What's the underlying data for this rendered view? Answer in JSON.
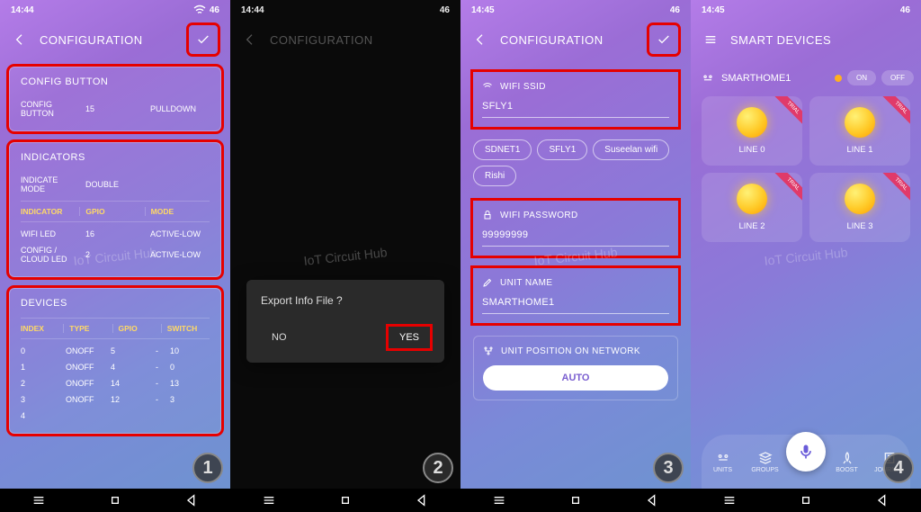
{
  "status": {
    "time1": "14:44",
    "time2": "14:44",
    "time3": "14:45",
    "time4": "14:45",
    "battery": "46"
  },
  "s1": {
    "title": "CONFIGURATION",
    "config_button": {
      "title": "CONFIG BUTTON",
      "label": "CONFIG BUTTON",
      "value": "15",
      "mode": "PULLDOWN"
    },
    "indicators": {
      "title": "INDICATORS",
      "mode_label": "INDICATE MODE",
      "mode_value": "DOUBLE",
      "head": {
        "c1": "INDICATOR",
        "c2": "GPIO",
        "c3": "MODE"
      },
      "rows": [
        {
          "c1": "WIFI LED",
          "c2": "16",
          "c3": "ACTIVE-LOW"
        },
        {
          "c1": "CONFIG / CLOUD LED",
          "c2": "2",
          "c3": "ACTIVE-LOW"
        }
      ]
    },
    "devices": {
      "title": "DEVICES",
      "head": {
        "c1": "INDEX",
        "c2": "TYPE",
        "c3": "GPIO",
        "c4": "SWITCH"
      },
      "rows": [
        {
          "c1": "0",
          "c2": "ONOFF",
          "c3": "5",
          "sep": "-",
          "c4": "10"
        },
        {
          "c1": "1",
          "c2": "ONOFF",
          "c3": "4",
          "sep": "-",
          "c4": "0"
        },
        {
          "c1": "2",
          "c2": "ONOFF",
          "c3": "14",
          "sep": "-",
          "c4": "13"
        },
        {
          "c1": "3",
          "c2": "ONOFF",
          "c3": "12",
          "sep": "-",
          "c4": "3"
        },
        {
          "c1": "4",
          "c2": "",
          "c3": "",
          "sep": "",
          "c4": ""
        }
      ]
    }
  },
  "s2": {
    "title": "CONFIGURATION",
    "dialog": {
      "title": "Export Info File ?",
      "no": "NO",
      "yes": "YES"
    }
  },
  "s3": {
    "title": "CONFIGURATION",
    "ssid": {
      "label": "WIFI SSID",
      "value": "SFLY1"
    },
    "chips": [
      "SDNET1",
      "SFLY1",
      "Suseelan wifi",
      "Rishi"
    ],
    "password": {
      "label": "WIFI PASSWORD",
      "value": "99999999"
    },
    "unitname": {
      "label": "UNIT NAME",
      "value": "SMARTHOME1"
    },
    "position": {
      "label": "UNIT POSITION ON NETWORK",
      "auto": "AUTO"
    }
  },
  "s4": {
    "title": "SMART DEVICES",
    "device": "SMARTHOME1",
    "on": "ON",
    "off": "OFF",
    "trial": "TRIAL",
    "tiles": [
      "LINE 0",
      "LINE 1",
      "LINE 2",
      "LINE 3"
    ],
    "nav": {
      "units": "UNITS",
      "groups": "GROUPS",
      "boost": "BOOST",
      "journal": "JOURNAL"
    }
  },
  "steps": {
    "s1": "1",
    "s2": "2",
    "s3": "3",
    "s4": "4"
  },
  "watermark": "IoT Circuit Hub"
}
